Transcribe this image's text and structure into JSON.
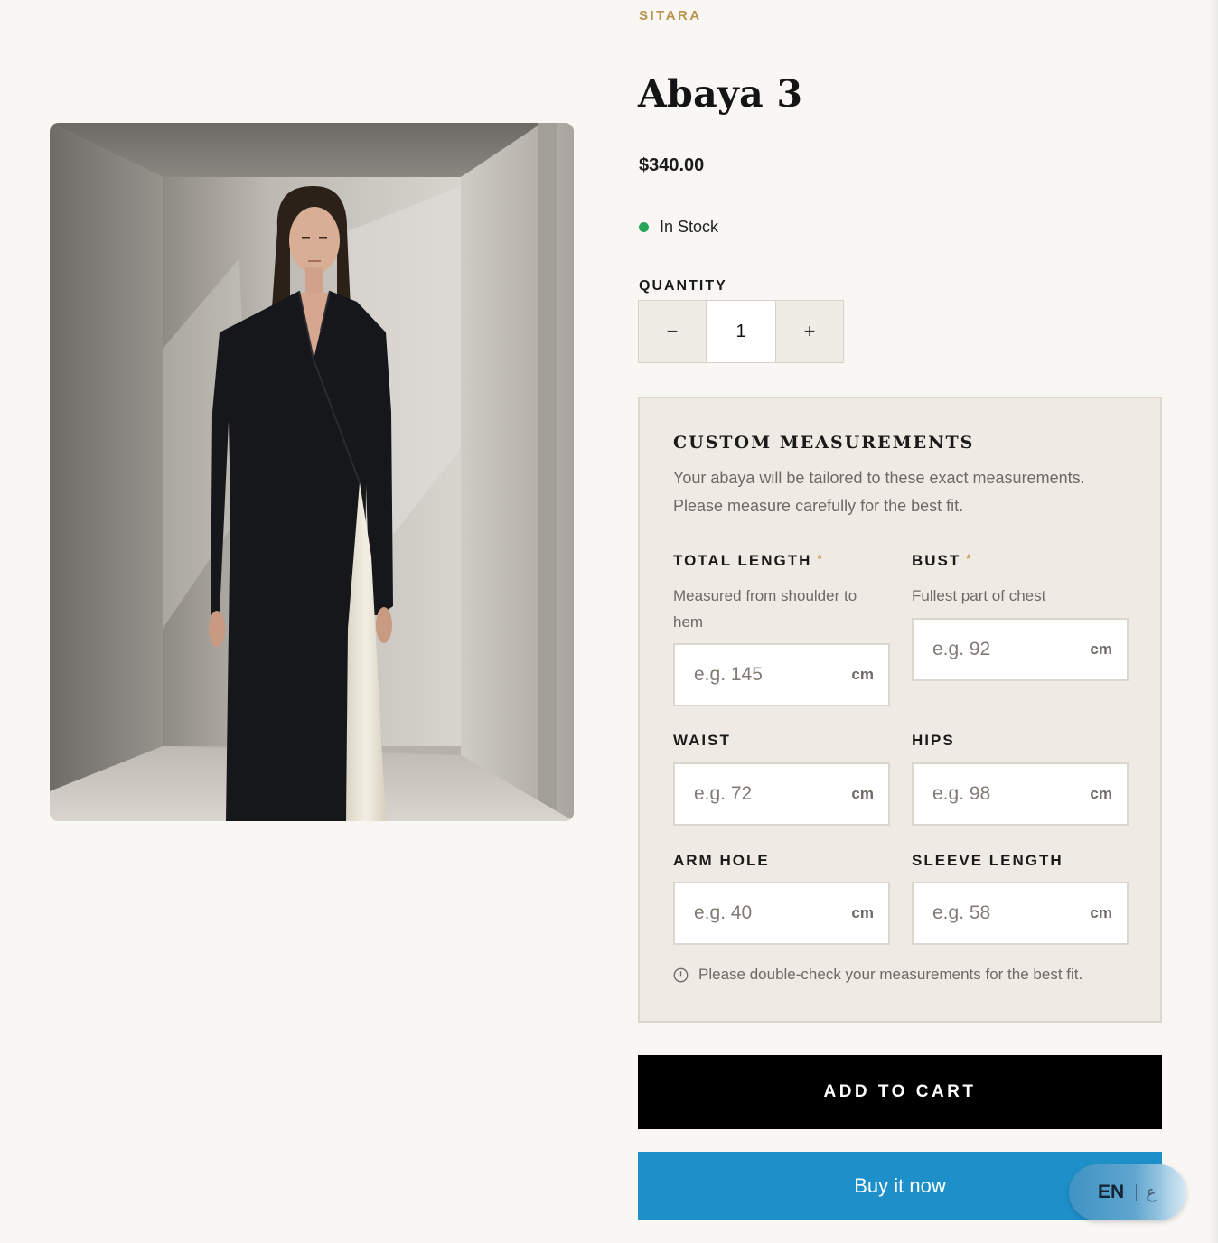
{
  "brand": "SITARA",
  "product": {
    "title": "Abaya 3",
    "price": "$340.00",
    "stock_status": "In Stock",
    "stock_color": "#27a35a",
    "image_alt": "Model wearing a black tailored abaya with an ivory inner panel in a concrete room"
  },
  "quantity": {
    "label": "QUANTITY",
    "value": "1",
    "decrement_symbol": "−",
    "increment_symbol": "+"
  },
  "measurements": {
    "title": "CUSTOM MEASUREMENTS",
    "description": "Your abaya will be tailored to these exact measurements. Please measure carefully for the best fit.",
    "required_marker": "*",
    "unit": "cm",
    "fields": [
      {
        "label": "TOTAL LENGTH",
        "required": true,
        "help": "Measured from shoulder to hem",
        "placeholder": "e.g. 145"
      },
      {
        "label": "BUST",
        "required": true,
        "help": "Fullest part of chest",
        "placeholder": "e.g. 92"
      },
      {
        "label": "WAIST",
        "required": false,
        "help": "",
        "placeholder": "e.g. 72"
      },
      {
        "label": "HIPS",
        "required": false,
        "help": "",
        "placeholder": "e.g. 98"
      },
      {
        "label": "ARM HOLE",
        "required": false,
        "help": "",
        "placeholder": "e.g. 40"
      },
      {
        "label": "SLEEVE LENGTH",
        "required": false,
        "help": "",
        "placeholder": "e.g. 58"
      }
    ],
    "note": "Please double-check your measurements for the best fit."
  },
  "actions": {
    "add_to_cart": "ADD TO CART",
    "buy_now": "Buy it now"
  },
  "language": {
    "current": "EN",
    "alternate": "ع"
  },
  "colors": {
    "accent_gold": "#b8944e",
    "buy_now_blue": "#1e90c9",
    "add_to_cart_black": "#000000"
  }
}
